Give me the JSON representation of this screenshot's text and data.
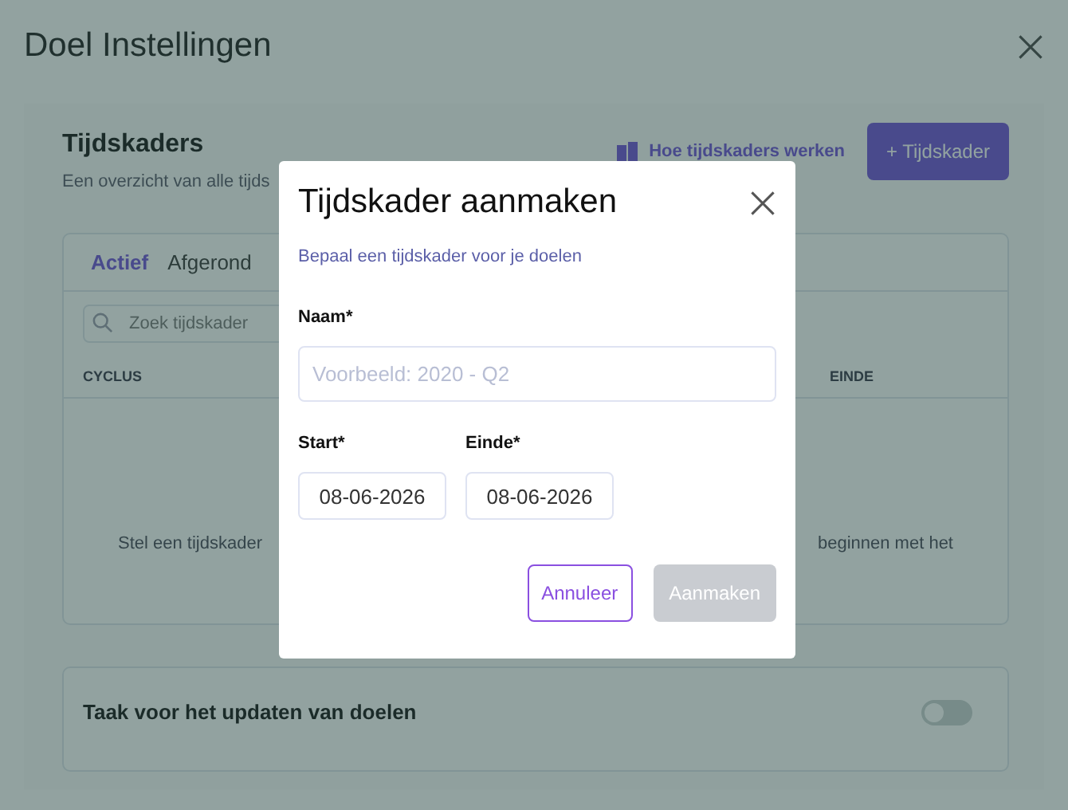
{
  "window": {
    "title": "Doel Instellingen"
  },
  "timeframes": {
    "title": "Tijdskaders",
    "subtitle": "Een overzicht van alle tijds",
    "help_link": "Hoe tijdskaders werken",
    "add_button": "+ Tijdskader"
  },
  "table_card": {
    "tabs": [
      {
        "label": "Actief",
        "selected": true
      },
      {
        "label": "Afgerond",
        "selected": false
      }
    ],
    "search": {
      "placeholder": "Zoek tijdskader"
    },
    "columns": [
      "CYCLUS",
      "EINDE"
    ],
    "empty_text": [
      "Stel een tijdskader",
      "beginnen met het"
    ]
  },
  "task_card": {
    "label": "Taak voor het updaten van doelen",
    "on": false
  },
  "modal": {
    "title": "Tijdskader aanmaken",
    "subtitle": "Bepaal een tijdskader voor je doelen",
    "name": {
      "label": "Naam*",
      "placeholder": "Voorbeeld: 2020 - Q2"
    },
    "start": {
      "label": "Start*",
      "value": "08-06-2026"
    },
    "end": {
      "label": "Einde*",
      "value": "08-06-2026"
    },
    "buttons": [
      {
        "label": "Annuleer",
        "kind": "secondary"
      },
      {
        "label": "Aanmaken",
        "kind": "primary",
        "disabled": true
      }
    ]
  }
}
